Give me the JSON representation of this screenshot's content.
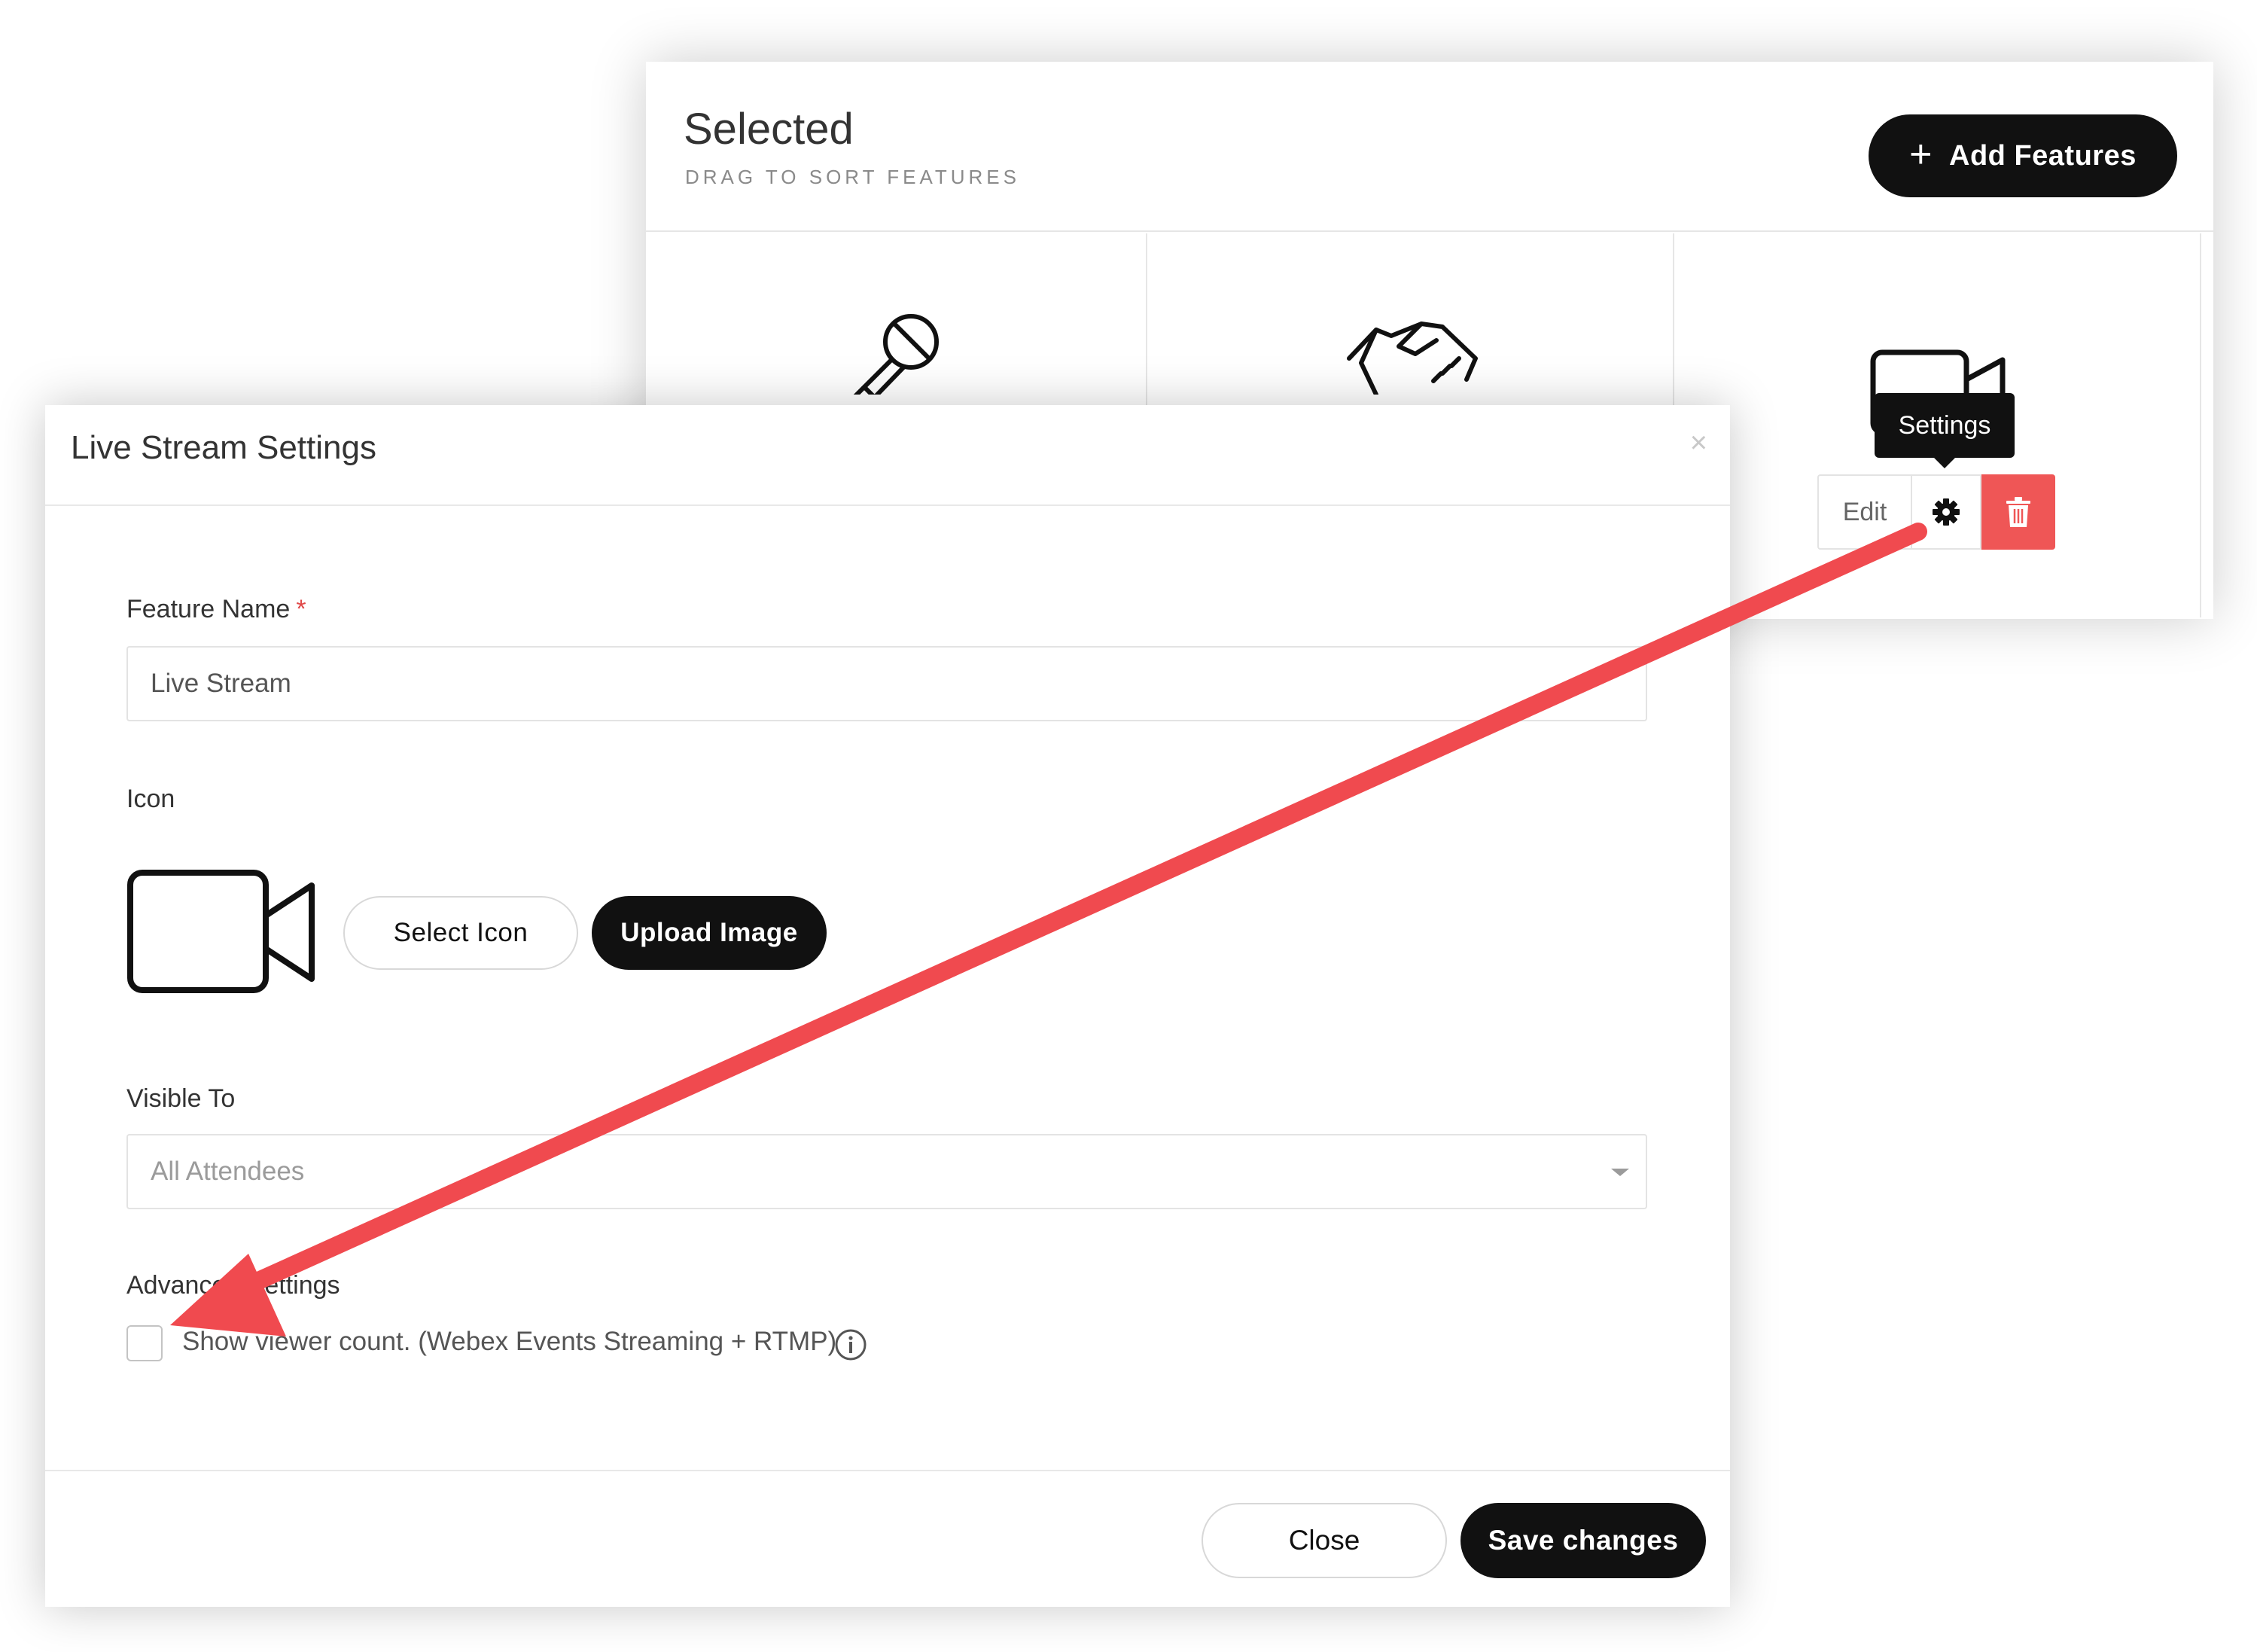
{
  "background_panel": {
    "title": "Selected",
    "subtitle": "DRAG TO SORT FEATURES",
    "add_features_label": "Add Features",
    "add_features_icon": "plus-icon",
    "tiles": [
      {
        "icon": "microphone-icon"
      },
      {
        "icon": "handshake-icon"
      },
      {
        "icon": "video-camera-icon"
      }
    ],
    "tooltip": "Settings",
    "actions": {
      "edit_label": "Edit",
      "settings_icon": "gear-icon",
      "delete_icon": "trash-icon"
    }
  },
  "modal": {
    "title": "Live Stream Settings",
    "close_icon": "close-icon",
    "feature_name": {
      "label": "Feature Name",
      "required_mark": "*",
      "value": "Live Stream"
    },
    "icon_section": {
      "label": "Icon",
      "preview_icon": "video-camera-icon",
      "select_icon_label": "Select Icon",
      "upload_image_label": "Upload Image"
    },
    "visible_to": {
      "label": "Visible To",
      "selected": "All Attendees"
    },
    "advanced": {
      "label": "Advanced Settings",
      "checkbox_label": "Show viewer count. (Webex Events Streaming + RTMP)",
      "checked": false,
      "info_icon": "info-icon"
    },
    "footer": {
      "close_label": "Close",
      "save_label": "Save changes"
    }
  },
  "colors": {
    "primary_button": "#111111",
    "danger": "#ef5656",
    "annotation_arrow": "#f04a4f",
    "required": "#e04848"
  }
}
